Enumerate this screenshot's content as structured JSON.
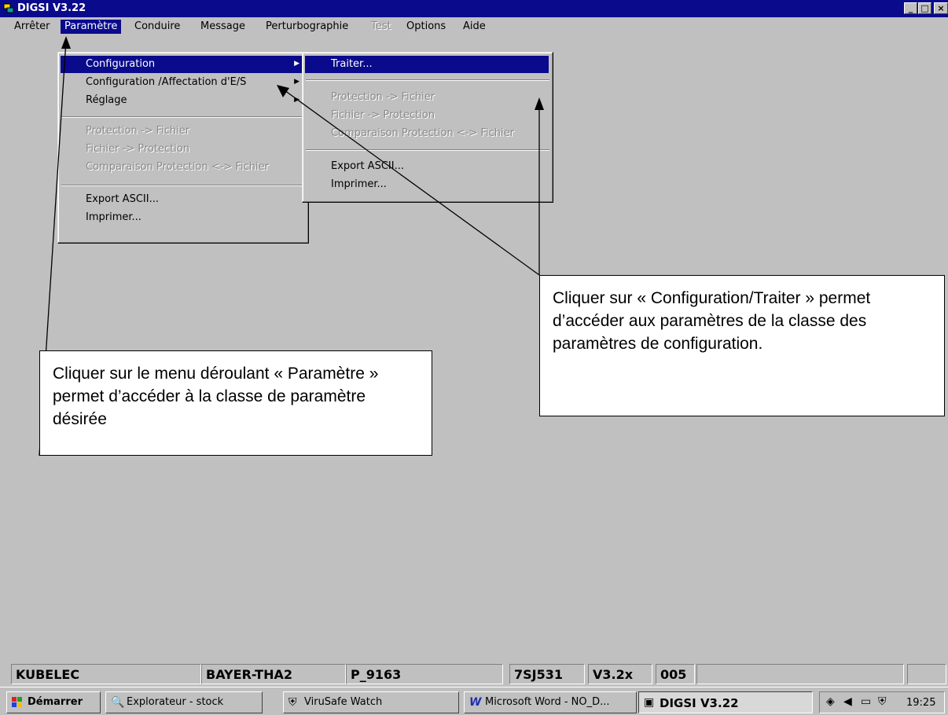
{
  "window": {
    "title": "DIGSI  V3.22",
    "controls": [
      "_",
      "□",
      "×"
    ]
  },
  "menubar": {
    "items": [
      {
        "label": "Arrêter",
        "state": "normal"
      },
      {
        "label": "Paramètre",
        "state": "active"
      },
      {
        "label": "Conduire",
        "state": "normal"
      },
      {
        "label": "Message",
        "state": "normal"
      },
      {
        "label": "Perturbographie",
        "state": "normal"
      },
      {
        "label": "Test",
        "state": "disabled"
      },
      {
        "label": "Options",
        "state": "normal"
      },
      {
        "label": "Aide",
        "state": "normal"
      }
    ]
  },
  "parametre_menu": {
    "items": [
      {
        "label": "Configuration",
        "submenu": "▶",
        "state": "highlighted"
      },
      {
        "label": "Configuration /Affectation d'E/S",
        "submenu": "▶",
        "state": "normal"
      },
      {
        "label": "Réglage",
        "submenu": "▶",
        "state": "normal"
      },
      {
        "label": "Protection -> Fichier",
        "state": "disabled"
      },
      {
        "label": "Fichier -> Protection",
        "state": "disabled"
      },
      {
        "label": "Comparaison Protection <-> Fichier",
        "state": "disabled"
      },
      {
        "label": "Export ASCII...",
        "state": "normal"
      },
      {
        "label": "Imprimer...",
        "state": "normal"
      }
    ]
  },
  "configuration_submenu": {
    "items": [
      {
        "label": "Traiter...",
        "state": "highlighted"
      },
      {
        "label": "Protection -> Fichier",
        "state": "disabled"
      },
      {
        "label": "Fichier -> Protection",
        "state": "disabled"
      },
      {
        "label": "Comparaison Protection <-> Fichier",
        "state": "disabled"
      },
      {
        "label": "Export ASCII...",
        "state": "normal"
      },
      {
        "label": "Imprimer...",
        "state": "normal"
      }
    ]
  },
  "callouts": {
    "right": "Cliquer sur « Configuration/Traiter » permet d’accéder aux paramètres de la classe des paramètres de configuration.",
    "left": "Cliquer sur le menu déroulant « Paramètre » permet d’accéder à la classe de paramètre désirée"
  },
  "statusbar": {
    "cells": [
      "KUBELEC",
      "BAYER-THA2",
      "P_9163",
      "7SJ531",
      "V3.2x",
      "005",
      "",
      ""
    ]
  },
  "taskbar": {
    "start": "Démarrer",
    "tasks": [
      {
        "label": "Explorateur - stock",
        "icon": "explorer-icon"
      },
      {
        "label": "ViruSafe Watch",
        "icon": "virusafe-icon"
      },
      {
        "label": "Microsoft Word - NO_D...",
        "icon": "word-icon"
      },
      {
        "label": "DIGSI  V3.22",
        "icon": "digsi-icon"
      }
    ],
    "clock": "19:25"
  },
  "colors": {
    "titlebar": "#0a0a8c",
    "highlight": "#0a0a8c",
    "face": "#c0c0c0"
  }
}
